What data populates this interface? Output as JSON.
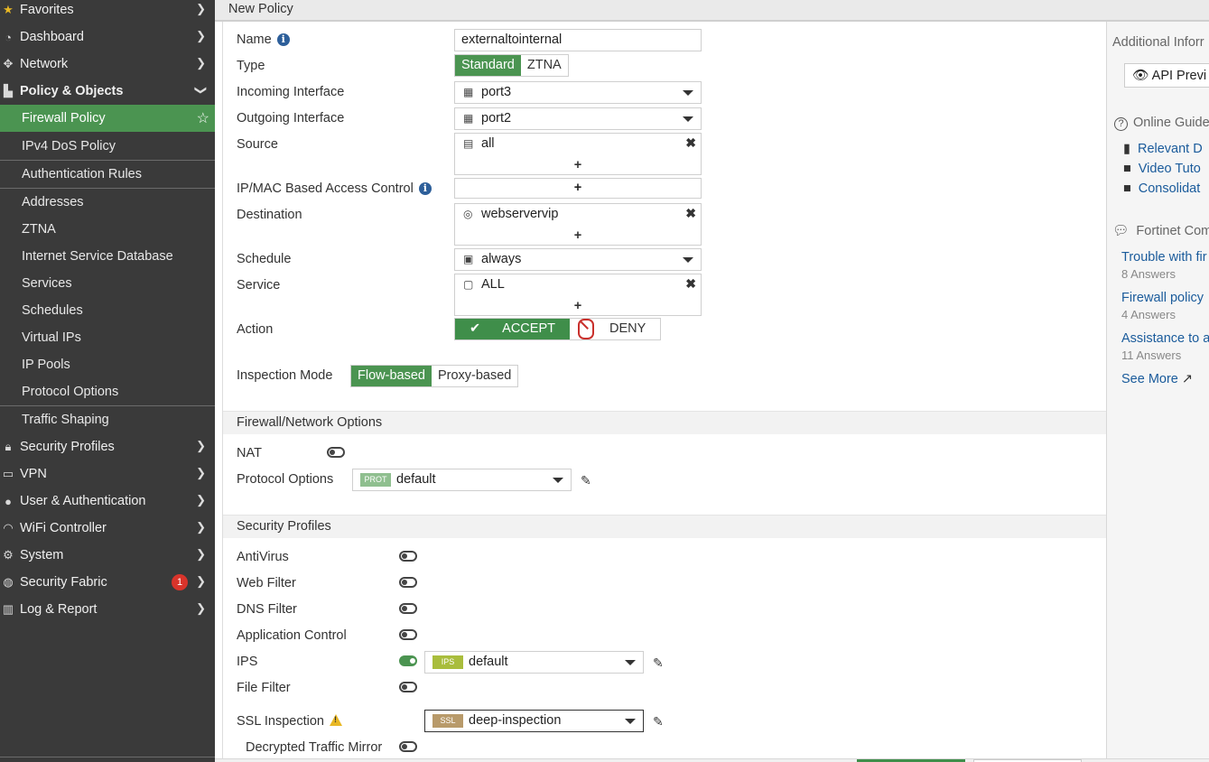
{
  "header": {
    "title": "New Policy"
  },
  "sidebar": {
    "items": [
      {
        "label": "Favorites",
        "icon": "star-icon"
      },
      {
        "label": "Dashboard",
        "icon": "dashboard-icon"
      },
      {
        "label": "Network",
        "icon": "network-icon"
      },
      {
        "label": "Policy & Objects",
        "icon": "policy-icon"
      },
      {
        "label": "Security Profiles",
        "icon": "lock-icon"
      },
      {
        "label": "VPN",
        "icon": "laptop-icon"
      },
      {
        "label": "User & Authentication",
        "icon": "user-icon"
      },
      {
        "label": "WiFi Controller",
        "icon": "wifi-icon"
      },
      {
        "label": "System",
        "icon": "gear-icon"
      },
      {
        "label": "Security Fabric",
        "icon": "fabric-icon",
        "badge": "1"
      },
      {
        "label": "Log & Report",
        "icon": "chart-icon"
      }
    ],
    "sub_items": [
      "Firewall Policy",
      "IPv4 DoS Policy",
      "Authentication Rules",
      "Addresses",
      "ZTNA",
      "Internet Service Database",
      "Services",
      "Schedules",
      "Virtual IPs",
      "IP Pools",
      "Protocol Options",
      "Traffic Shaping"
    ]
  },
  "form": {
    "name_label": "Name",
    "name_value": "externaltointernal",
    "type_label": "Type",
    "type_options": [
      "Standard",
      "ZTNA"
    ],
    "incoming_label": "Incoming Interface",
    "incoming_value": "port3",
    "outgoing_label": "Outgoing Interface",
    "outgoing_value": "port2",
    "source_label": "Source",
    "source_value": "all",
    "ipmac_label": "IP/MAC Based Access Control",
    "destination_label": "Destination",
    "destination_value": "webservervip",
    "schedule_label": "Schedule",
    "schedule_value": "always",
    "service_label": "Service",
    "service_value": "ALL",
    "action_label": "Action",
    "accept_label": "ACCEPT",
    "deny_label": "DENY",
    "inspection_label": "Inspection Mode",
    "inspection_options": [
      "Flow-based",
      "Proxy-based"
    ],
    "plus": "+"
  },
  "firewall_section": {
    "title": "Firewall/Network Options",
    "nat_label": "NAT",
    "nat_enabled": false,
    "protocol_label": "Protocol Options",
    "protocol_tag": "PROT",
    "protocol_value": "default"
  },
  "security_section": {
    "title": "Security Profiles",
    "antivirus_label": "AntiVirus",
    "webfilter_label": "Web Filter",
    "dnsfilter_label": "DNS Filter",
    "appcontrol_label": "Application Control",
    "ips_label": "IPS",
    "ips_enabled": true,
    "ips_tag": "IPS",
    "ips_value": "default",
    "filefilter_label": "File Filter",
    "ssl_label": "SSL Inspection",
    "ssl_tag": "SSL",
    "ssl_value": "deep-inspection",
    "mirror_label": "Decrypted Traffic Mirror"
  },
  "right_panel": {
    "additional_info": "Additional Inforr",
    "api_preview": "API Previ",
    "online_guides": "Online Guide",
    "link1": "Relevant D",
    "link2": "Video Tuto",
    "link3": "Consolidat",
    "community": "Fortinet Com",
    "q1": "Trouble with fir",
    "q1_answers": "8  Answers",
    "q2": "Firewall policy",
    "q2_answers": "4  Answers",
    "q3": "Assistance to a",
    "q3_answers": "11  Answers",
    "see_more": "See More"
  },
  "colors": {
    "accent_green": "#4b9451",
    "sidebar_bg": "#3a3a3a",
    "link_blue": "#1a5b9b"
  }
}
